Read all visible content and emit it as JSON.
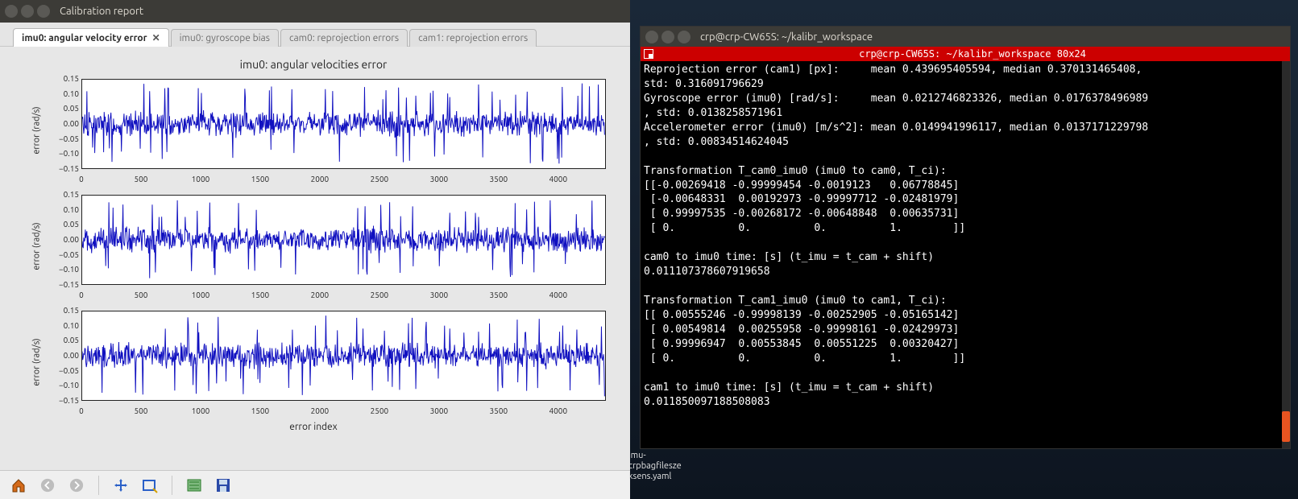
{
  "report": {
    "window_title": "Calibration report",
    "tabs": [
      {
        "label": "imu0: angular velocity error",
        "active": true,
        "closable": true
      },
      {
        "label": "imu0: gyroscope bias",
        "active": false
      },
      {
        "label": "cam0: reprojection errors",
        "active": false
      },
      {
        "label": "cam1: reprojection errors",
        "active": false
      }
    ],
    "plot_title": "imu0: angular velocities error",
    "xlabel": "error index",
    "ylabel": "error (rad/s)",
    "yticks": [
      "0.15",
      "0.10",
      "0.05",
      "0.00",
      "−0.05",
      "−0.10",
      "−0.15"
    ],
    "xticks": [
      "0",
      "500",
      "1000",
      "1500",
      "2000",
      "2500",
      "3000",
      "3500",
      "4000"
    ],
    "toolbar_icons": [
      "home",
      "back",
      "forward",
      "sep",
      "pan",
      "zoom",
      "sep",
      "config",
      "save"
    ]
  },
  "chart_data": [
    {
      "type": "line",
      "title": "imu0: angular velocities error",
      "xlabel": "error index",
      "ylabel": "error (rad/s)",
      "xlim": [
        0,
        4400
      ],
      "ylim": [
        -0.15,
        0.15
      ],
      "note": "noisy gyroscope error signal, 3 axes shown in 3 stacked subplots; values oscillate mostly within ±0.05 rad/s with occasional spikes to ±0.10",
      "series_per_axis": 3,
      "approx_std": 0.02
    }
  ],
  "terminal": {
    "window_title": "crp@crp-CW65S: ~/kalibr_workspace",
    "redbar_text": "crp@crp-CW65S: ~/kalibr_workspace 80x24",
    "lines": [
      "Reprojection error (cam1) [px]:     mean 0.439695405594, median 0.370131465408,",
      "std: 0.316091796629",
      "Gyroscope error (imu0) [rad/s]:     mean 0.0212746823326, median 0.0176378496989",
      ", std: 0.0138258571961",
      "Accelerometer error (imu0) [m/s^2]: mean 0.0149941996117, median 0.0137171229798",
      ", std: 0.00834514624045",
      "",
      "Transformation T_cam0_imu0 (imu0 to cam0, T_ci):",
      "[[-0.00269418 -0.99999454 -0.0019123   0.06778845]",
      " [-0.00648331  0.00192973 -0.99997712 -0.02481979]",
      " [ 0.99997535 -0.00268172 -0.00648848  0.00635731]",
      " [ 0.          0.          0.          1.        ]]",
      "",
      "cam0 to imu0 time: [s] (t_imu = t_cam + shift)",
      "0.011107378607919658",
      "",
      "Transformation T_cam1_imu0 (imu0 to cam1, T_ci):",
      "[[ 0.00555246 -0.99998139 -0.00252905 -0.05165142]",
      " [ 0.00549814  0.00255958 -0.99998161 -0.02429973]",
      " [ 0.99996947  0.00553845  0.00551225  0.00320427]",
      " [ 0.          0.          0.          1.        ]]",
      "",
      "cam1 to imu0 time: [s] (t_imu = t_cam + shift)",
      "0.011850097188508083"
    ]
  },
  "desktop_files": [
    "imu-",
    "crpbagfilesze",
    "ksens.yaml"
  ]
}
